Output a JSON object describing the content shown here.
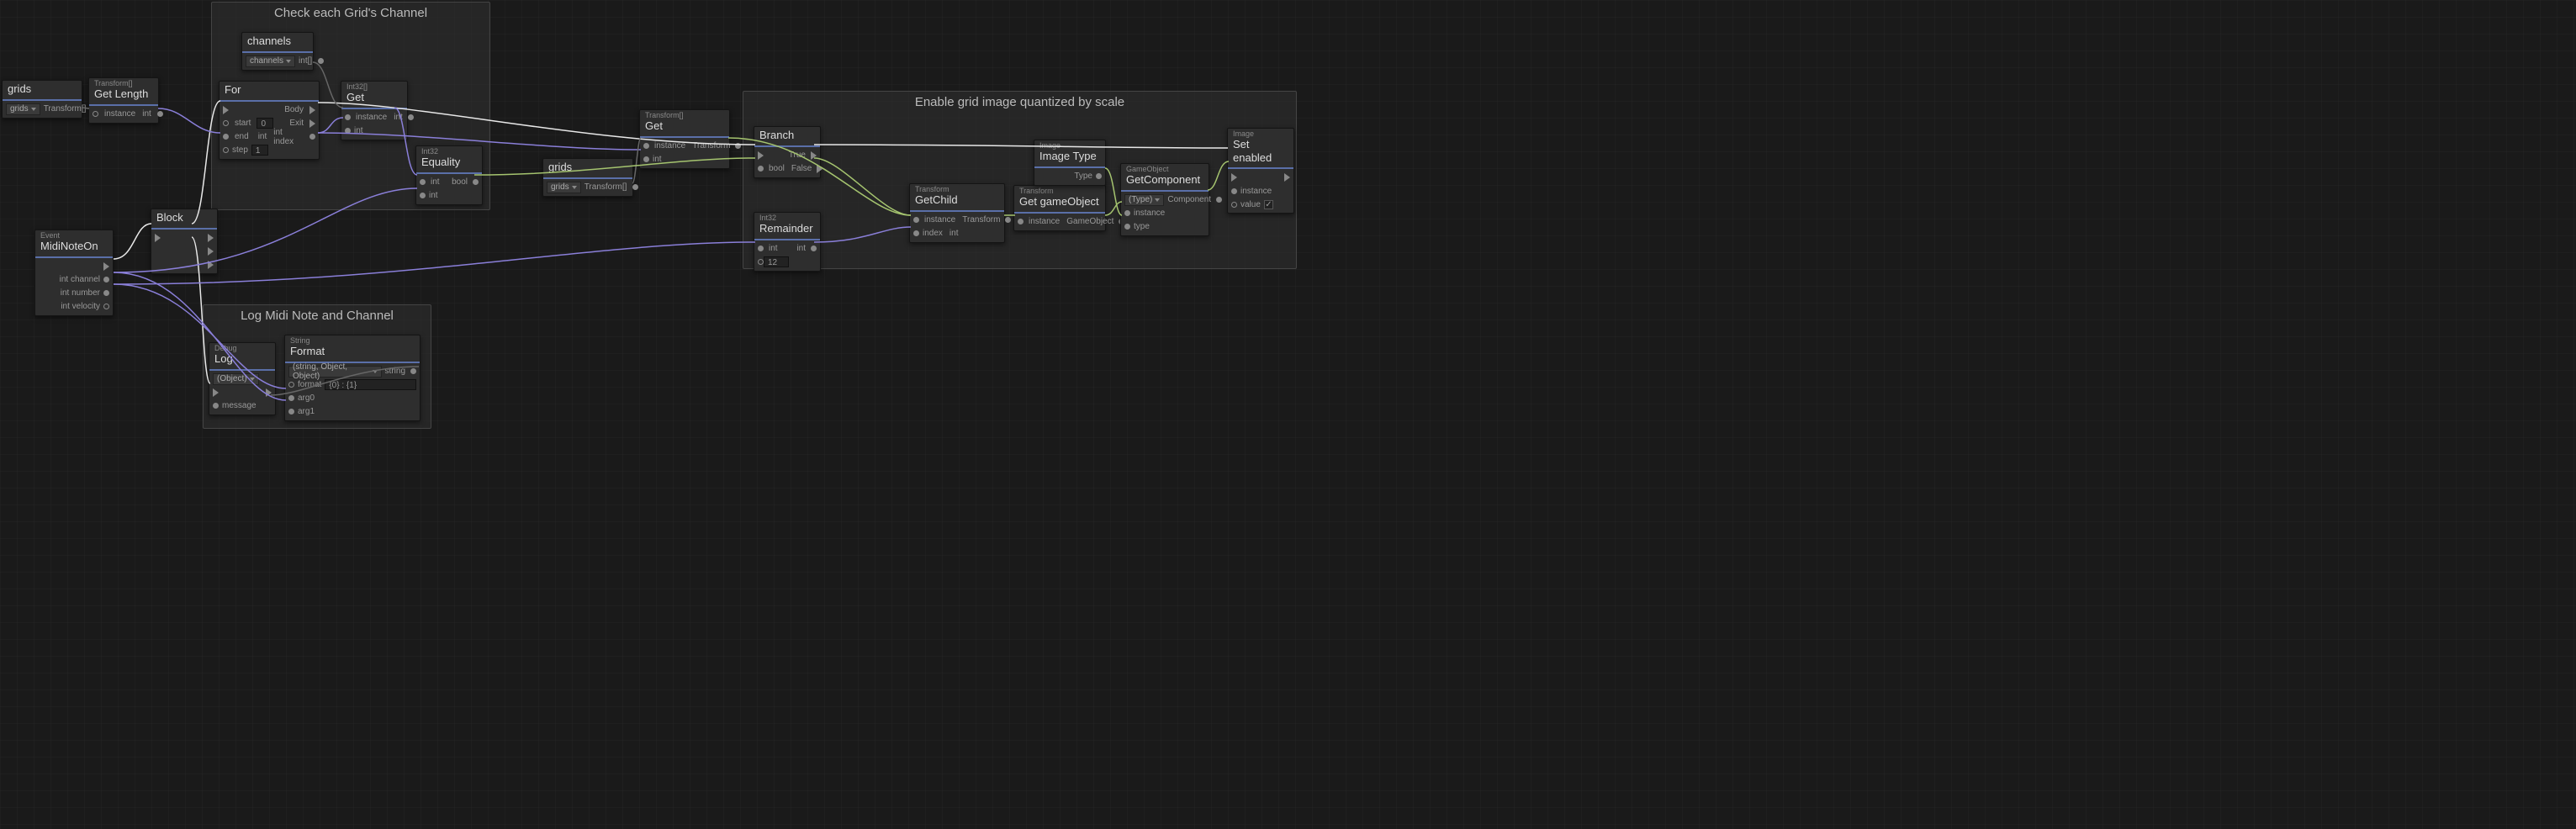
{
  "groups": {
    "check": {
      "title": "Check each Grid's Channel"
    },
    "log": {
      "title": "Log Midi Note and Channel"
    },
    "enable": {
      "title": "Enable grid image quantized by scale"
    }
  },
  "nodes": {
    "gridsVar": {
      "title": "grids",
      "dropdown": "grids",
      "outType": "Transform[]"
    },
    "getLength": {
      "category": "Transform[]",
      "title": "Get Length",
      "in": "instance",
      "out": "int"
    },
    "channels": {
      "title": "channels",
      "dropdown": "channels",
      "outType": "int[]"
    },
    "for": {
      "title": "For",
      "start": {
        "label": "start",
        "value": "0"
      },
      "end": {
        "label": "end",
        "type": "int"
      },
      "step": {
        "label": "step",
        "value": "1"
      },
      "body": "Body",
      "exit": "Exit",
      "index": {
        "label": "int index",
        "type": "int"
      }
    },
    "getInt": {
      "category": "Int32[]",
      "title": "Get",
      "in1": "instance",
      "in2": "int",
      "out": "int"
    },
    "equality": {
      "category": "Int32",
      "title": "Equality",
      "in1": "int",
      "in2": "int",
      "out": "bool"
    },
    "gridsVar2": {
      "title": "grids",
      "dropdown": "grids",
      "outType": "Transform[]"
    },
    "getTransform": {
      "category": "Transform[]",
      "title": "Get",
      "in1": "instance",
      "in2": "int",
      "out": "Transform"
    },
    "block": {
      "title": "Block"
    },
    "midiNoteOn": {
      "category": "Event",
      "title": "MidiNoteOn",
      "out1": "int channel",
      "out2": "int number",
      "out3": "int velocity"
    },
    "log": {
      "category": "Debug",
      "title": "Log",
      "dropdown": "(Object)",
      "in": "message"
    },
    "format": {
      "category": "String",
      "title": "Format",
      "overload": "(string, Object, Object)",
      "formatLabel": "format",
      "formatValue": "{0} : {1}",
      "arg0": "arg0",
      "arg1": "arg1",
      "out": "string"
    },
    "branch": {
      "title": "Branch",
      "inBool": "bool",
      "outTrue": "True",
      "outFalse": "False"
    },
    "remainder": {
      "category": "Int32",
      "title": "Remainder",
      "in1": "int",
      "in2Value": "12",
      "out": "int"
    },
    "getChild": {
      "category": "Transform",
      "title": "GetChild",
      "in1": "instance",
      "in2": "index",
      "in2Type": "int",
      "out": "Transform"
    },
    "getGameObject": {
      "category": "Transform",
      "title": "Get gameObject",
      "in": "instance",
      "out": "GameObject"
    },
    "imageType": {
      "category": "Image",
      "title": "Image Type",
      "out": "Type"
    },
    "getComponent": {
      "category": "GameObject",
      "title": "GetComponent",
      "dropdown": "(Type)",
      "in1": "instance",
      "in2": "type",
      "out": "Component"
    },
    "setEnabled": {
      "category": "Image",
      "title": "Set enabled",
      "in1": "instance",
      "in2": "value",
      "checked": true
    }
  }
}
